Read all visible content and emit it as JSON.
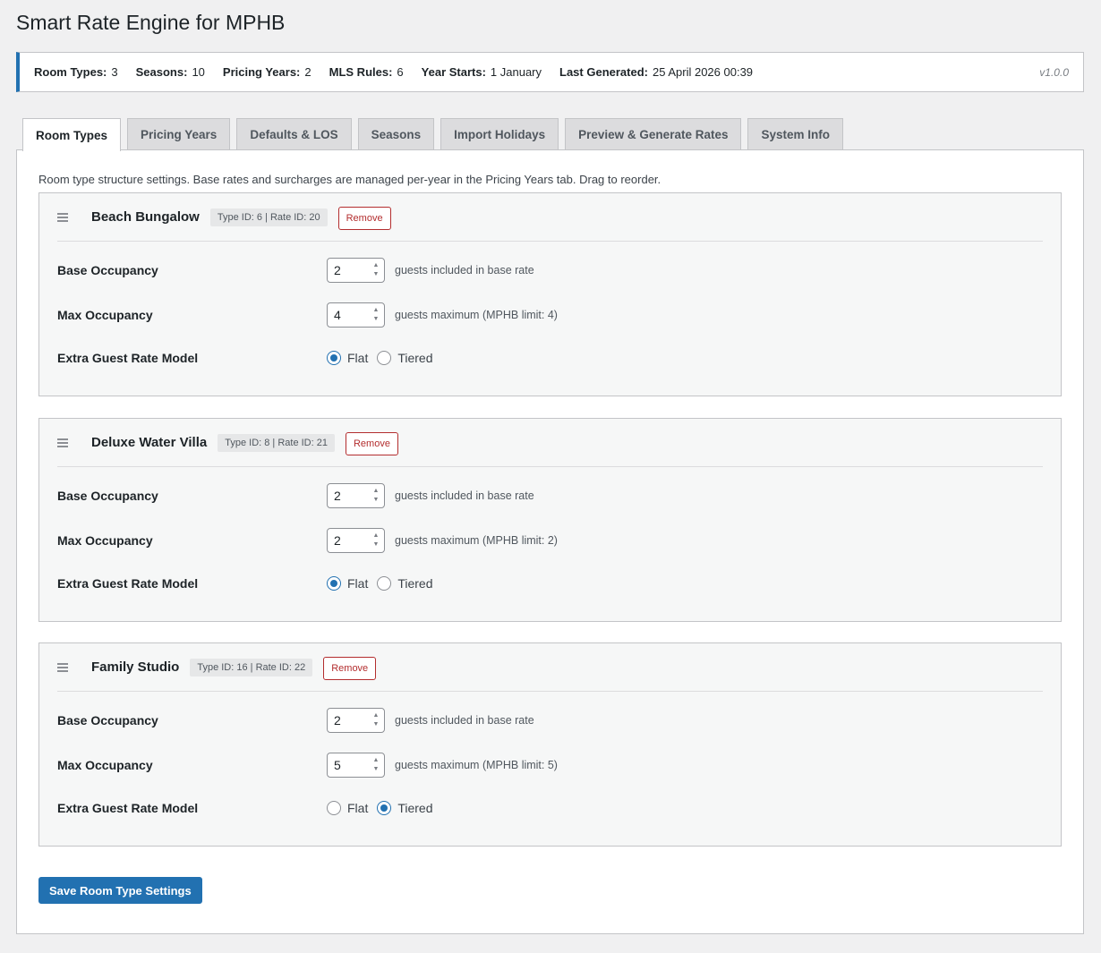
{
  "page": {
    "title": "Smart Rate Engine for MPHB"
  },
  "stats": {
    "room_types_label": "Room Types:",
    "room_types_value": "3",
    "seasons_label": "Seasons:",
    "seasons_value": "10",
    "pricing_years_label": "Pricing Years:",
    "pricing_years_value": "2",
    "mls_rules_label": "MLS Rules:",
    "mls_rules_value": "6",
    "year_starts_label": "Year Starts:",
    "year_starts_value": "1 January",
    "last_generated_label": "Last Generated:",
    "last_generated_value": "25 April 2026 00:39",
    "version": "v1.0.0"
  },
  "tabs": [
    {
      "label": "Room Types",
      "active": true
    },
    {
      "label": "Pricing Years"
    },
    {
      "label": "Defaults & LOS"
    },
    {
      "label": "Seasons"
    },
    {
      "label": "Import Holidays"
    },
    {
      "label": "Preview & Generate Rates"
    },
    {
      "label": "System Info"
    }
  ],
  "intro": "Room type structure settings. Base rates and surcharges are managed per-year in the Pricing Years tab. Drag to reorder.",
  "labels": {
    "base_occupancy": "Base Occupancy",
    "max_occupancy": "Max Occupancy",
    "extra_guest_model": "Extra Guest Rate Model",
    "base_hint": "guests included in base rate",
    "flat": "Flat",
    "tiered": "Tiered",
    "remove": "Remove"
  },
  "rooms": [
    {
      "name": "Beach Bungalow",
      "ids": "Type ID: 6 | Rate ID: 20",
      "base_occupancy": "2",
      "max_occupancy": "4",
      "max_hint": "guests maximum (MPHB limit: 4)",
      "model": "flat"
    },
    {
      "name": "Deluxe Water Villa",
      "ids": "Type ID: 8 | Rate ID: 21",
      "base_occupancy": "2",
      "max_occupancy": "2",
      "max_hint": "guests maximum (MPHB limit: 2)",
      "model": "flat"
    },
    {
      "name": "Family Studio",
      "ids": "Type ID: 16 | Rate ID: 22",
      "base_occupancy": "2",
      "max_occupancy": "5",
      "max_hint": "guests maximum (MPHB limit: 5)",
      "model": "tiered"
    }
  ],
  "save_button": "Save Room Type Settings",
  "colors": {
    "accent": "#2271b1",
    "danger": "#b32d2e"
  },
  "icons": {
    "drag": "drag-handle-icon",
    "spinner": "spinner-arrows-icon"
  }
}
